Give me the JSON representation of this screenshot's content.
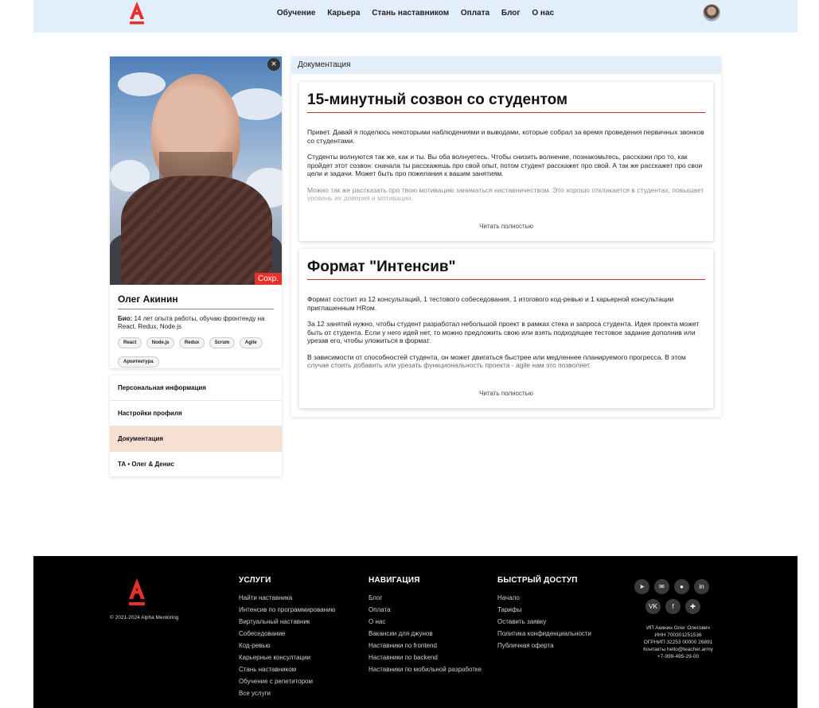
{
  "header": {
    "nav": [
      "Обучение",
      "Карьера",
      "Стань наставником",
      "Оплата",
      "Блог",
      "О нас"
    ]
  },
  "profile": {
    "save_label": "Сохр.",
    "close_label": "×",
    "name": "Олег Акинин",
    "bio_label": "Био:",
    "bio_text": " 14 лет опыта работы, обучаю фронтенду на React, Redux, Node.js",
    "tags": [
      "React",
      "Node.js",
      "Redux",
      "Scrum",
      "Agile",
      "Архитектура"
    ]
  },
  "menu": {
    "items": [
      "Персональная информация",
      "Настройки профиля",
      "Документация",
      "ТА • Олег & Денис"
    ],
    "active_index": 2
  },
  "docs": {
    "header": "Документация",
    "articles": [
      {
        "title": "15-минутный созвон со студентом",
        "paragraphs": [
          "Привет. Давай я поделюсь некоторыми наблюдениями и выводами, которые собрал за время проведения первичных звонков со студентами.",
          "Студенты волнуются так же, как и ты. Вы оба волнуетесь. Чтобы снизить волнение, познакомьтесь, расскажи про то, как пройдет этот созвон: сначала ты расскажешь про свой опыт, потом студент расскажет про свой. А так же расскажет про свои цели и задачи. Может быть про пожелания к вашим занятиям.",
          "Можно так же рассказать про твою мотивацию заниматься наставничеством. Это хорошо откликается в студентах, повышает уровень их доверия и мотивации."
        ],
        "read_more": "Читать полностью"
      },
      {
        "title": "Формат \"Интенсив\"",
        "paragraphs": [
          "Формат состоит из 12 консультаций, 1 тестового собеседования, 1 итогового код-ревью и 1 карьерной консультации приглашенным HRом.",
          "За 12 занятий нужно, чтобы студент разработал небольшой проект в рамках стека и запроса студента. Идея проекта может быть от студента. Если у него идей нет, то можно предложить свою или взять подходящее тестовое задание дополнив или урезав его, чтобы уложиться в формат.",
          "В зависимости от способностей студента, он может двигаться быстрее или медленнее планируемого прогресса. В этом случае стоить добавить или урезать функциональность проекта - agile нам это позволяет."
        ],
        "read_more": "Читать полностью"
      }
    ]
  },
  "footer": {
    "copyright": "© 2021-2024 Alpha Mentoring",
    "services": {
      "title": "УСЛУГИ",
      "links": [
        "Найти наставника",
        "Интенсив по программированию",
        "Виртуальный наставник",
        "Собеседование",
        "Код-ревью",
        "Карьерные консултации",
        "Стань наставником",
        "Обучение с репетитором",
        "Все услуги"
      ]
    },
    "navigation": {
      "title": "НАВИГАЦИЯ",
      "links": [
        "Блог",
        "Оплата",
        "О нас",
        "Вакансии для джунов",
        "Наставники по frontend",
        "Наставники по backend",
        "Наставники по мобильной разработке"
      ]
    },
    "quick": {
      "title": "БЫСТРЫЙ ДОСТУП",
      "links": [
        "Начало",
        "Тарифы",
        "Оставить заявку",
        "Политика конфиденциальности",
        "Публичная оферта"
      ]
    },
    "socials": [
      {
        "icon": "telegram-icon",
        "glyph": "➤"
      },
      {
        "icon": "mail-icon",
        "glyph": "✉"
      },
      {
        "icon": "github-icon",
        "glyph": "●"
      },
      {
        "icon": "linkedin-icon",
        "glyph": "in"
      },
      {
        "icon": "vk-icon",
        "glyph": "VK"
      },
      {
        "icon": "facebook-icon",
        "glyph": "f"
      },
      {
        "icon": "plus-icon",
        "glyph": "✚"
      }
    ],
    "contacts": [
      "ИП Акинин Олег Олегович",
      "ИНН 700301251536",
      "ОГРНИП 32253 00000 26891",
      "Контакты hello@teacher.army",
      "+7-999-495-29-00"
    ]
  },
  "colors": {
    "accent": "#e8312b",
    "header_bg": "#e3eefb",
    "active_menu": "#f7dfd4",
    "footer_bg": "#000000"
  }
}
